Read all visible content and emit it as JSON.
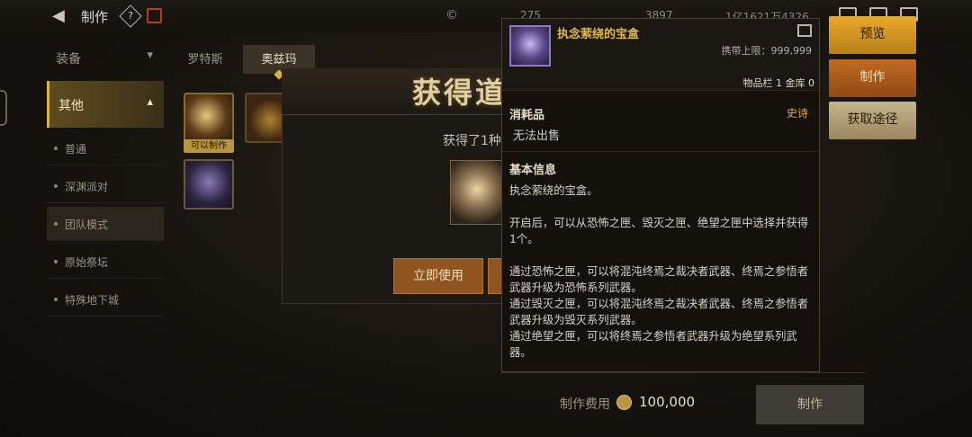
{
  "header": {
    "title": "制作",
    "help_glyph": "?",
    "currency_1": "275",
    "currency_2": "3897",
    "currency_3": "1亿1621万4326"
  },
  "categories": {
    "equipment": "装备",
    "other": "其他",
    "sub_items": [
      "普通",
      "深渊派对",
      "团队模式",
      "原始祭坛",
      "特殊地下城"
    ]
  },
  "tabs": [
    "罗特斯",
    "奥兹玛"
  ],
  "grid": {
    "craft_tag": "可以制作"
  },
  "popup": {
    "title": "获得道",
    "text": "获得了1种",
    "use_button": "立即使用"
  },
  "tooltip": {
    "name": "执念萦绕的宝盒",
    "carry_limit": "携带上限：999,999",
    "inventory": "物品栏 1 金库 0",
    "type": "消耗品",
    "rarity": "史诗",
    "sell": "无法出售",
    "basic_title": "基本信息",
    "desc_1": "执念萦绕的宝盒。",
    "desc_2": "开启后，可以从恐怖之匣、毁灭之匣、绝望之匣中选择并获得1个。",
    "desc_3": "通过恐怖之匣，可以将混沌终焉之裁决者武器、终焉之参悟者武器升级为恐怖系列武器。",
    "desc_4": "通过毁灭之匣，可以将混沌终焉之裁决者武器、终焉之参悟者武器升级为毁灭系列武器。",
    "desc_5": "通过绝望之匣，可以将终焉之参悟者武器升级为绝望系列武器。"
  },
  "actions": {
    "preview": "预览",
    "craft": "制作",
    "source": "获取途径"
  },
  "footer": {
    "cost_label": "制作费用",
    "cost_value": "100,000",
    "craft_button": "制作"
  },
  "colors": {
    "accent_gold": "#d8b24a",
    "epic": "#e0a83a",
    "item_name": "#e0b94a"
  }
}
